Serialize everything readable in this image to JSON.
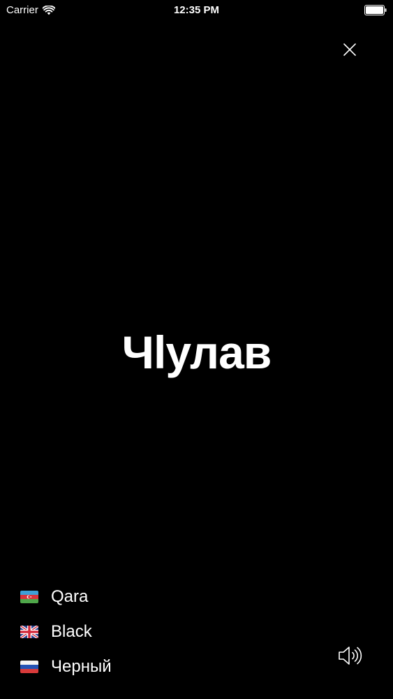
{
  "status_bar": {
    "carrier": "Carrier",
    "time": "12:35 PM",
    "wifi_icon": "wifi-icon",
    "battery_icon": "battery-icon"
  },
  "controls": {
    "close_icon": "close-icon",
    "speaker_icon": "speaker-icon"
  },
  "word": "Чlулав",
  "translations": [
    {
      "language_flag": "azerbaijan-flag-icon",
      "text": "Qara"
    },
    {
      "language_flag": "uk-flag-icon",
      "text": "Black"
    },
    {
      "language_flag": "russia-flag-icon",
      "text": "Черный"
    }
  ],
  "colors": {
    "background": "#000000",
    "text": "#ffffff"
  }
}
